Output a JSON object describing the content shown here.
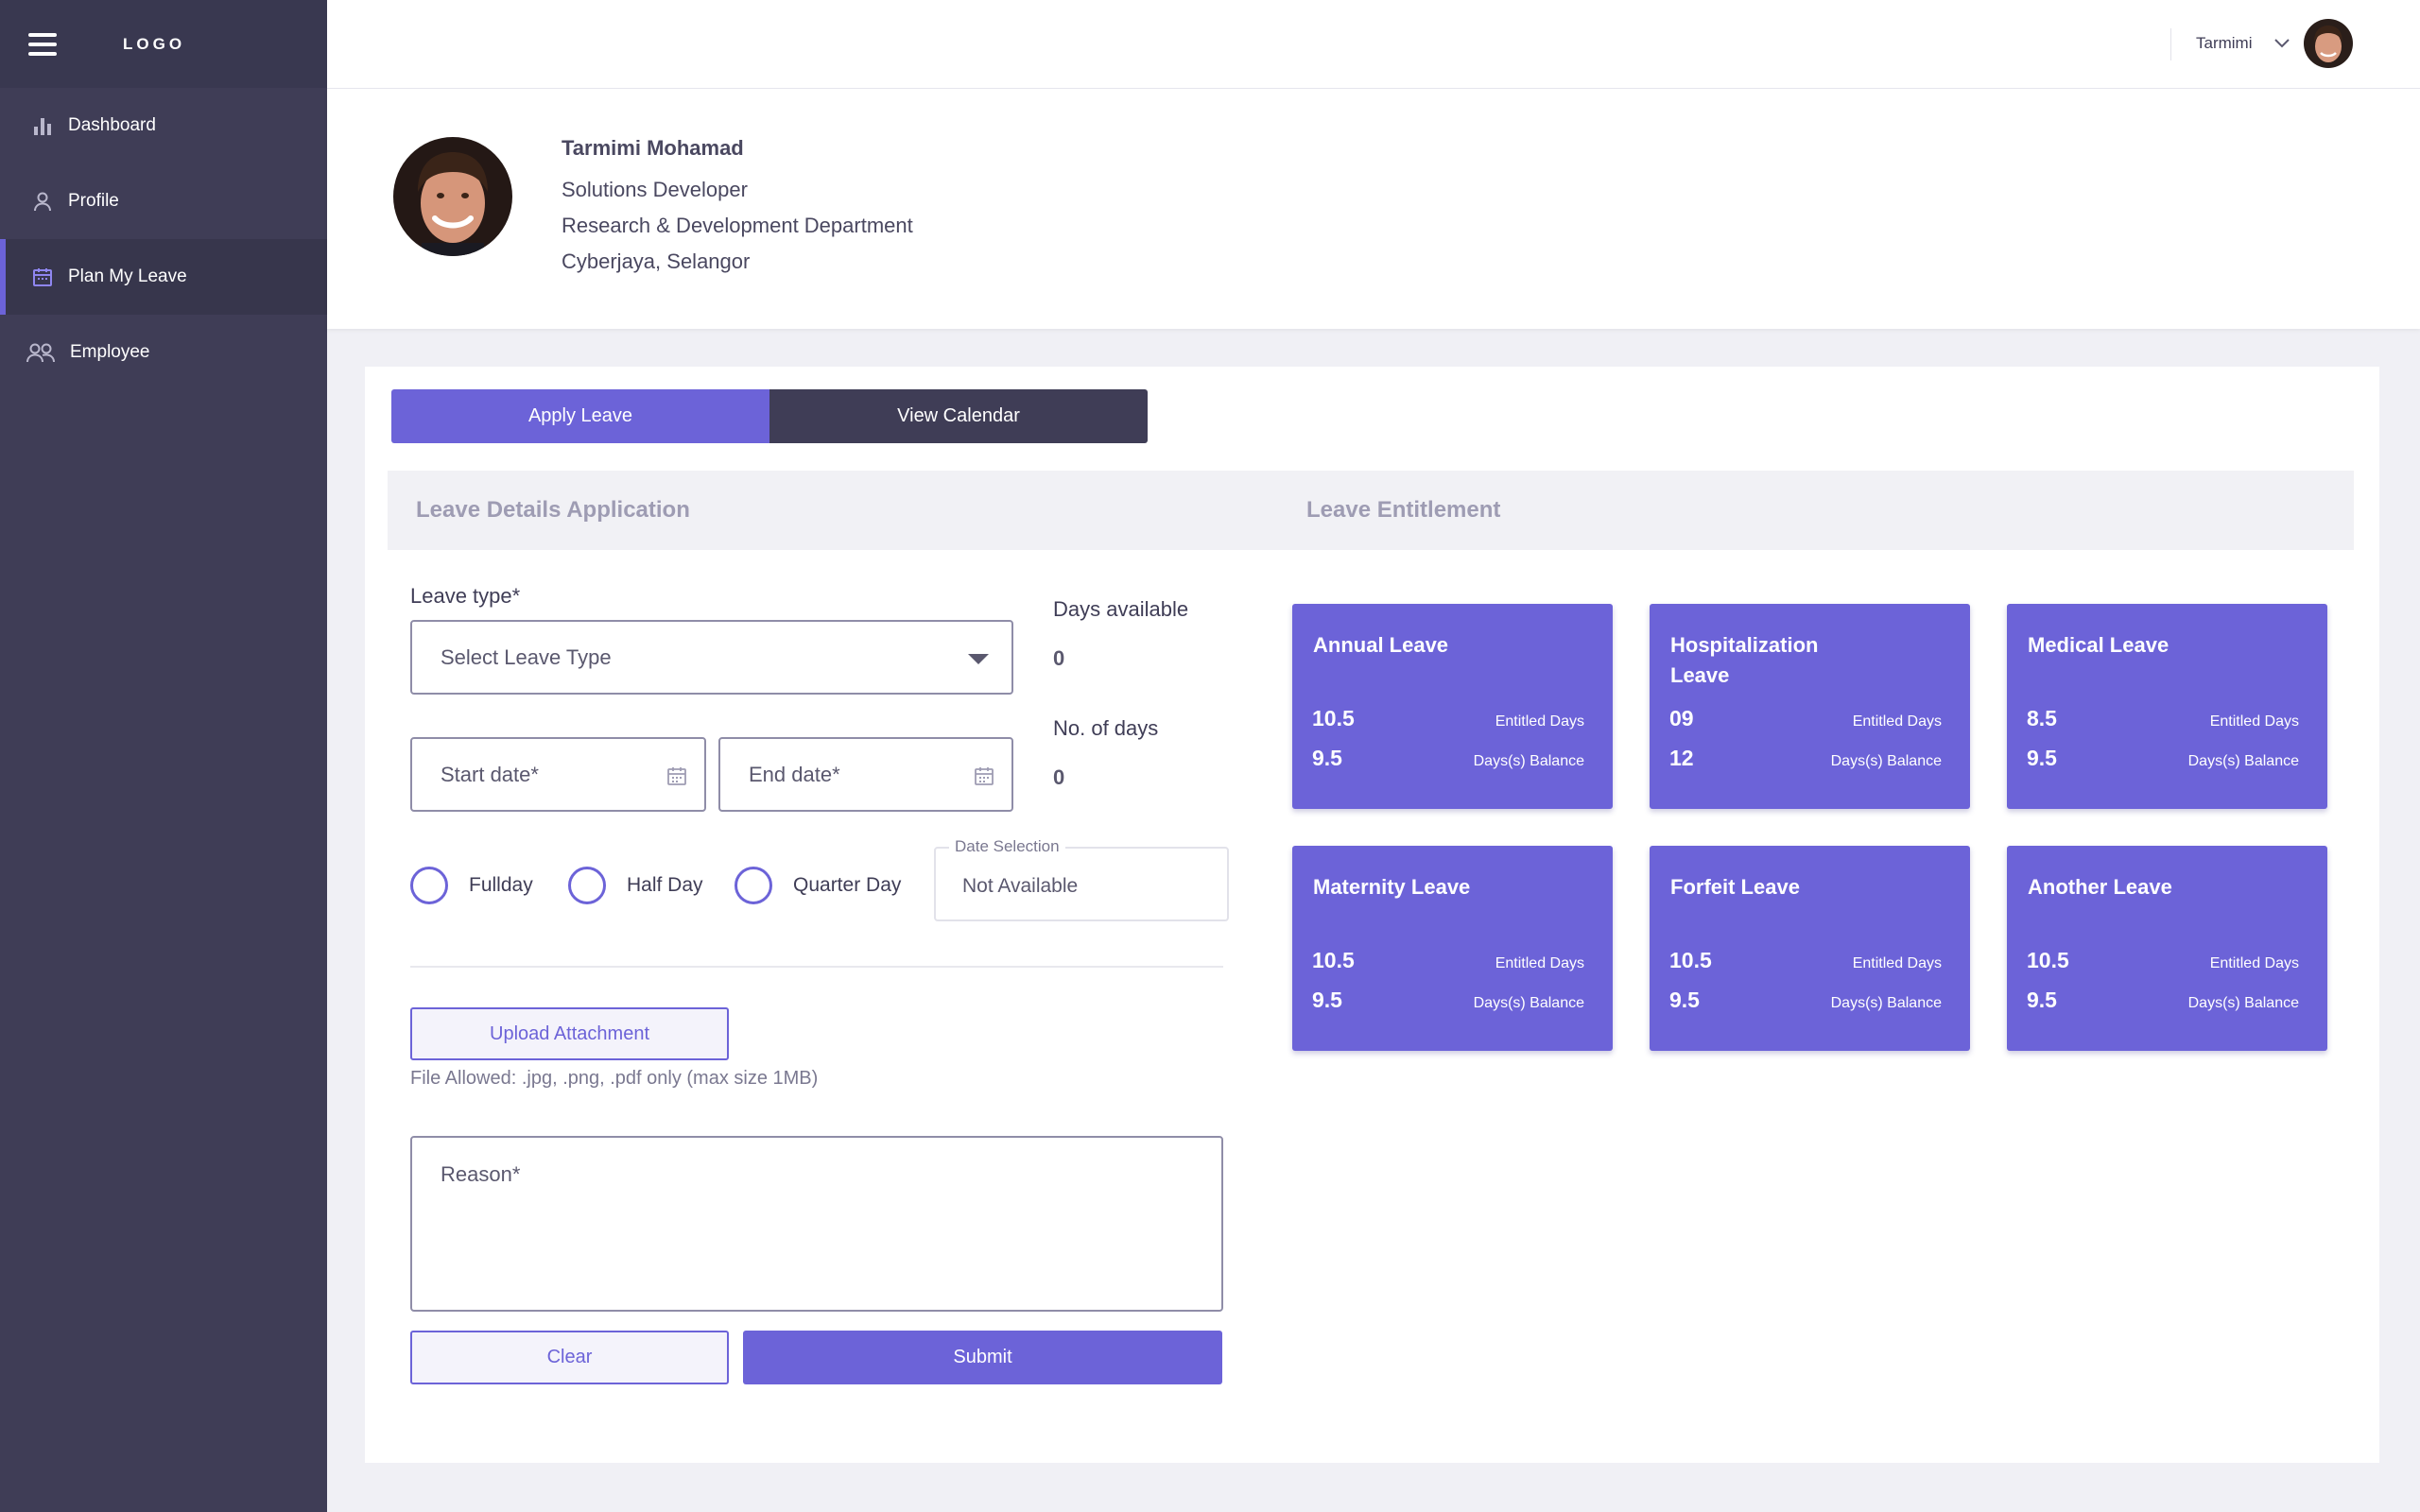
{
  "sidebar": {
    "logo": "LOGO",
    "items": [
      {
        "label": "Dashboard",
        "icon": "bar-chart-icon"
      },
      {
        "label": "Profile",
        "icon": "user-icon"
      },
      {
        "label": "Plan My Leave",
        "icon": "calendar-icon",
        "active": true
      },
      {
        "label": "Employee",
        "icon": "users-icon"
      }
    ]
  },
  "topbar": {
    "user_name": "Tarmimi"
  },
  "profile": {
    "name": "Tarmimi Mohamad",
    "title": "Solutions Developer",
    "department": "Research & Development Department",
    "location": "Cyberjaya, Selangor"
  },
  "tabs": {
    "apply": "Apply Leave",
    "calendar": "View Calendar"
  },
  "sections": {
    "details": "Leave Details Application",
    "entitlement": "Leave Entitlement"
  },
  "form": {
    "leave_type_label": "Leave type*",
    "leave_type_placeholder": "Select Leave Type",
    "start_date_placeholder": "Start date*",
    "end_date_placeholder": "End date*",
    "days_available_label": "Days available",
    "days_available_value": "0",
    "no_of_days_label": "No. of days",
    "no_of_days_value": "0",
    "radio_options": [
      "Fullday",
      "Half Day",
      "Quarter Day"
    ],
    "date_selection_label": "Date Selection",
    "date_selection_value": "Not Available",
    "upload_label": "Upload Attachment",
    "file_note": "File Allowed: .jpg, .png, .pdf only (max size 1MB)",
    "reason_placeholder": "Reason*",
    "clear_label": "Clear",
    "submit_label": "Submit"
  },
  "entitled_caption": "Entitled Days",
  "balance_caption": "Days(s) Balance",
  "leave_cards": [
    {
      "title": "Annual Leave",
      "entitled": "10.5",
      "balance": "9.5"
    },
    {
      "title": "Hospitalization Leave",
      "entitled": "09",
      "balance": "12"
    },
    {
      "title": "Medical Leave",
      "entitled": "8.5",
      "balance": "9.5"
    },
    {
      "title": "Maternity Leave",
      "entitled": "10.5",
      "balance": "9.5"
    },
    {
      "title": "Forfeit Leave",
      "entitled": "10.5",
      "balance": "9.5"
    },
    {
      "title": "Another Leave",
      "entitled": "10.5",
      "balance": "9.5"
    }
  ],
  "colors": {
    "accent": "#6c63d8",
    "sidebar": "#3f3d56",
    "background": "#f0f0f5"
  }
}
